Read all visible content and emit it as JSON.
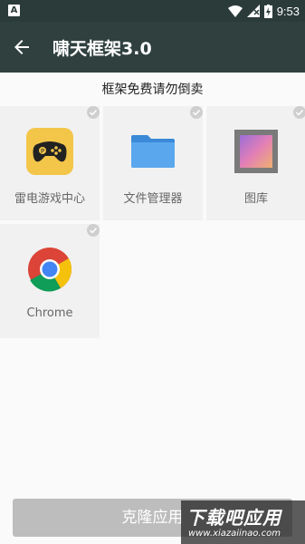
{
  "status_bar": {
    "badge": "A",
    "time": "9:53"
  },
  "app_bar": {
    "title": "啸天框架3.0",
    "back_icon": "arrow-left-icon"
  },
  "notice": "框架免费请勿倒卖",
  "apps": [
    {
      "label": "雷电游戏中心",
      "icon": "gamepad-icon",
      "selected": false
    },
    {
      "label": "文件管理器",
      "icon": "folder-icon",
      "selected": false
    },
    {
      "label": "图库",
      "icon": "gallery-icon",
      "selected": false
    },
    {
      "label": "Chrome",
      "icon": "chrome-icon",
      "selected": false
    }
  ],
  "clone_button": "克隆应用",
  "watermark": {
    "title": "下载吧应用",
    "url": "www.xiazaiinao.com"
  },
  "colors": {
    "app_bar": "#2f403f",
    "status_bar": "#2b3b3a",
    "button": "#bdbdbd"
  }
}
